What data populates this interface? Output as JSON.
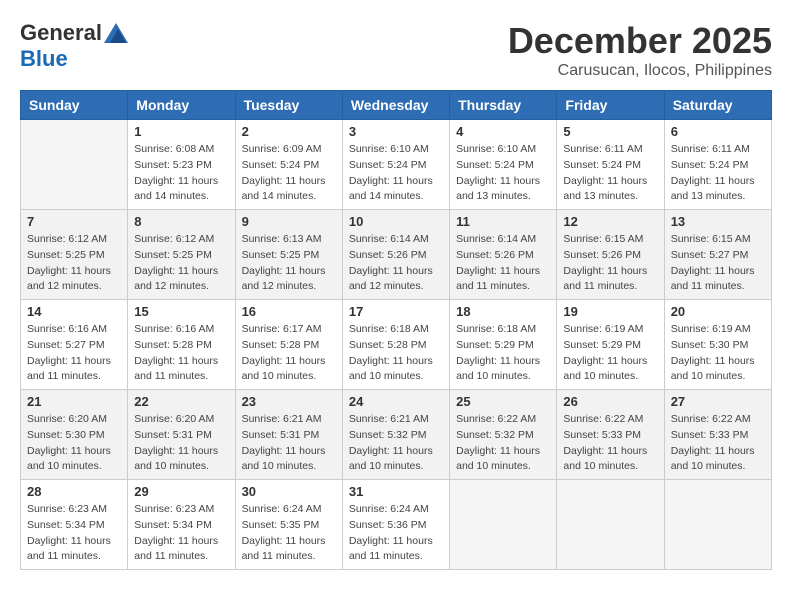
{
  "logo": {
    "general": "General",
    "blue": "Blue"
  },
  "title": "December 2025",
  "location": "Carusucan, Ilocos, Philippines",
  "headers": [
    "Sunday",
    "Monday",
    "Tuesday",
    "Wednesday",
    "Thursday",
    "Friday",
    "Saturday"
  ],
  "weeks": [
    [
      {
        "day": "",
        "info": ""
      },
      {
        "day": "1",
        "info": "Sunrise: 6:08 AM\nSunset: 5:23 PM\nDaylight: 11 hours\nand 14 minutes."
      },
      {
        "day": "2",
        "info": "Sunrise: 6:09 AM\nSunset: 5:24 PM\nDaylight: 11 hours\nand 14 minutes."
      },
      {
        "day": "3",
        "info": "Sunrise: 6:10 AM\nSunset: 5:24 PM\nDaylight: 11 hours\nand 14 minutes."
      },
      {
        "day": "4",
        "info": "Sunrise: 6:10 AM\nSunset: 5:24 PM\nDaylight: 11 hours\nand 13 minutes."
      },
      {
        "day": "5",
        "info": "Sunrise: 6:11 AM\nSunset: 5:24 PM\nDaylight: 11 hours\nand 13 minutes."
      },
      {
        "day": "6",
        "info": "Sunrise: 6:11 AM\nSunset: 5:24 PM\nDaylight: 11 hours\nand 13 minutes."
      }
    ],
    [
      {
        "day": "7",
        "info": "Sunrise: 6:12 AM\nSunset: 5:25 PM\nDaylight: 11 hours\nand 12 minutes."
      },
      {
        "day": "8",
        "info": "Sunrise: 6:12 AM\nSunset: 5:25 PM\nDaylight: 11 hours\nand 12 minutes."
      },
      {
        "day": "9",
        "info": "Sunrise: 6:13 AM\nSunset: 5:25 PM\nDaylight: 11 hours\nand 12 minutes."
      },
      {
        "day": "10",
        "info": "Sunrise: 6:14 AM\nSunset: 5:26 PM\nDaylight: 11 hours\nand 12 minutes."
      },
      {
        "day": "11",
        "info": "Sunrise: 6:14 AM\nSunset: 5:26 PM\nDaylight: 11 hours\nand 11 minutes."
      },
      {
        "day": "12",
        "info": "Sunrise: 6:15 AM\nSunset: 5:26 PM\nDaylight: 11 hours\nand 11 minutes."
      },
      {
        "day": "13",
        "info": "Sunrise: 6:15 AM\nSunset: 5:27 PM\nDaylight: 11 hours\nand 11 minutes."
      }
    ],
    [
      {
        "day": "14",
        "info": "Sunrise: 6:16 AM\nSunset: 5:27 PM\nDaylight: 11 hours\nand 11 minutes."
      },
      {
        "day": "15",
        "info": "Sunrise: 6:16 AM\nSunset: 5:28 PM\nDaylight: 11 hours\nand 11 minutes."
      },
      {
        "day": "16",
        "info": "Sunrise: 6:17 AM\nSunset: 5:28 PM\nDaylight: 11 hours\nand 10 minutes."
      },
      {
        "day": "17",
        "info": "Sunrise: 6:18 AM\nSunset: 5:28 PM\nDaylight: 11 hours\nand 10 minutes."
      },
      {
        "day": "18",
        "info": "Sunrise: 6:18 AM\nSunset: 5:29 PM\nDaylight: 11 hours\nand 10 minutes."
      },
      {
        "day": "19",
        "info": "Sunrise: 6:19 AM\nSunset: 5:29 PM\nDaylight: 11 hours\nand 10 minutes."
      },
      {
        "day": "20",
        "info": "Sunrise: 6:19 AM\nSunset: 5:30 PM\nDaylight: 11 hours\nand 10 minutes."
      }
    ],
    [
      {
        "day": "21",
        "info": "Sunrise: 6:20 AM\nSunset: 5:30 PM\nDaylight: 11 hours\nand 10 minutes."
      },
      {
        "day": "22",
        "info": "Sunrise: 6:20 AM\nSunset: 5:31 PM\nDaylight: 11 hours\nand 10 minutes."
      },
      {
        "day": "23",
        "info": "Sunrise: 6:21 AM\nSunset: 5:31 PM\nDaylight: 11 hours\nand 10 minutes."
      },
      {
        "day": "24",
        "info": "Sunrise: 6:21 AM\nSunset: 5:32 PM\nDaylight: 11 hours\nand 10 minutes."
      },
      {
        "day": "25",
        "info": "Sunrise: 6:22 AM\nSunset: 5:32 PM\nDaylight: 11 hours\nand 10 minutes."
      },
      {
        "day": "26",
        "info": "Sunrise: 6:22 AM\nSunset: 5:33 PM\nDaylight: 11 hours\nand 10 minutes."
      },
      {
        "day": "27",
        "info": "Sunrise: 6:22 AM\nSunset: 5:33 PM\nDaylight: 11 hours\nand 10 minutes."
      }
    ],
    [
      {
        "day": "28",
        "info": "Sunrise: 6:23 AM\nSunset: 5:34 PM\nDaylight: 11 hours\nand 11 minutes."
      },
      {
        "day": "29",
        "info": "Sunrise: 6:23 AM\nSunset: 5:34 PM\nDaylight: 11 hours\nand 11 minutes."
      },
      {
        "day": "30",
        "info": "Sunrise: 6:24 AM\nSunset: 5:35 PM\nDaylight: 11 hours\nand 11 minutes."
      },
      {
        "day": "31",
        "info": "Sunrise: 6:24 AM\nSunset: 5:36 PM\nDaylight: 11 hours\nand 11 minutes."
      },
      {
        "day": "",
        "info": ""
      },
      {
        "day": "",
        "info": ""
      },
      {
        "day": "",
        "info": ""
      }
    ]
  ]
}
